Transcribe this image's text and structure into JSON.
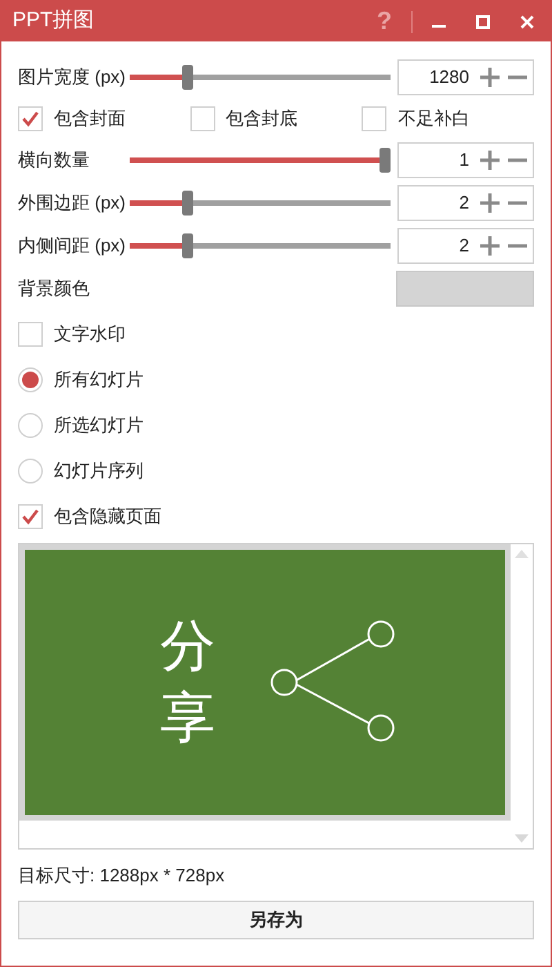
{
  "window": {
    "title": "PPT拼图",
    "help": "?"
  },
  "sliders": [
    {
      "label": "图片宽度 (px)",
      "level": 0.21,
      "value": "1280"
    },
    {
      "kind": "checks",
      "checks": [
        {
          "label": "包含封面",
          "checked": true
        },
        {
          "label": "包含封底",
          "checked": false
        },
        {
          "label": "不足补白",
          "checked": false
        }
      ]
    },
    {
      "label": "横向数量",
      "level": 1,
      "value": "1"
    },
    {
      "label": "外围边距 (px)",
      "level": 0.21,
      "value": "2"
    },
    {
      "label": "内侧间距 (px)",
      "level": 0.21,
      "value": "2"
    }
  ],
  "background_color": {
    "label": "背景颜色",
    "color": "#d4d4d4"
  },
  "text_watermark": {
    "label": "文字水印",
    "checked": false
  },
  "slide_scope": [
    {
      "label": "所有幻灯片",
      "selected": true
    },
    {
      "label": "所选幻灯片",
      "selected": false
    },
    {
      "label": "幻灯片序列",
      "selected": false
    }
  ],
  "include_hidden": {
    "label": "包含隐藏页面",
    "checked": true
  },
  "preview": {
    "slide_text": [
      "分",
      "享"
    ]
  },
  "target_size": "目标尺寸: 1288px * 728px",
  "save_button": "另存为"
}
